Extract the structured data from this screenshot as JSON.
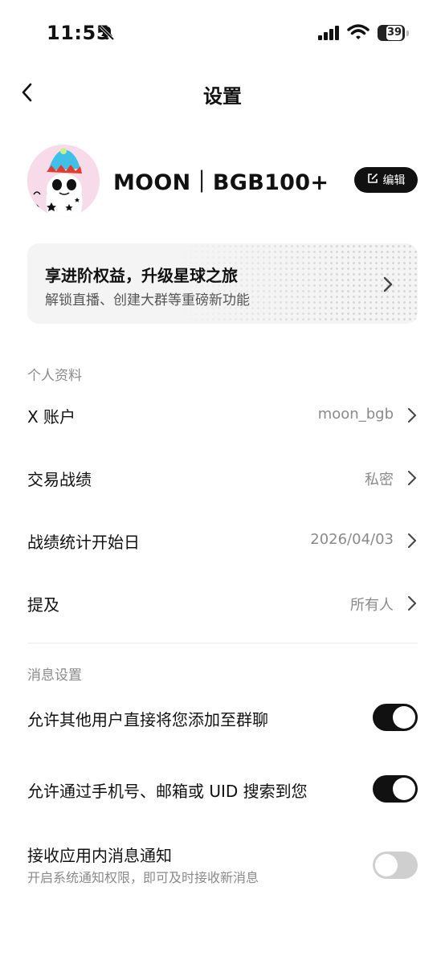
{
  "status_bar": {
    "time": "11:55",
    "battery": "39"
  },
  "header": {
    "title": "设置"
  },
  "profile": {
    "username": "MOON｜BGB100+",
    "edit_label": "编辑"
  },
  "banner": {
    "title": "享进阶权益，升级星球之旅",
    "subtitle": "解锁直播、创建大群等重磅新功能"
  },
  "personal": {
    "section_label": "个人资料",
    "rows": [
      {
        "label": "X 账户",
        "value": "moon_bgb"
      },
      {
        "label": "交易战绩",
        "value": "私密"
      },
      {
        "label": "战绩统计开始日",
        "value": "2026/04/03"
      },
      {
        "label": "提及",
        "value": "所有人"
      }
    ]
  },
  "message": {
    "section_label": "消息设置",
    "rows": [
      {
        "label": "允许其他用户直接将您添加至群聊",
        "enabled": true
      },
      {
        "label": "允许通过手机号、邮箱或 UID 搜索到您",
        "enabled": true
      },
      {
        "label": "接收应用内消息通知",
        "subtitle": "开启系统通知权限，即可及时接收新消息",
        "enabled": false
      }
    ]
  }
}
